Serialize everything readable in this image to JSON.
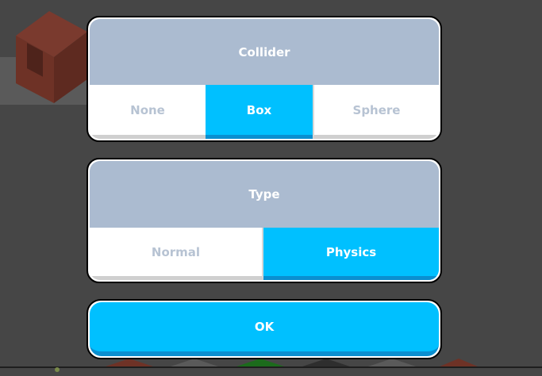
{
  "collider_panel": {
    "title": "Collider",
    "options": [
      "None",
      "Box",
      "Sphere"
    ],
    "selected": "Box"
  },
  "type_panel": {
    "title": "Type",
    "options": [
      "Normal",
      "Physics"
    ],
    "selected": "Physics"
  },
  "ok_button": {
    "label": "OK"
  },
  "colors": {
    "header": "#abbbd0",
    "selected": "#00c0ff",
    "unselected_text": "#b7c3d3",
    "backdrop": "#464646"
  }
}
